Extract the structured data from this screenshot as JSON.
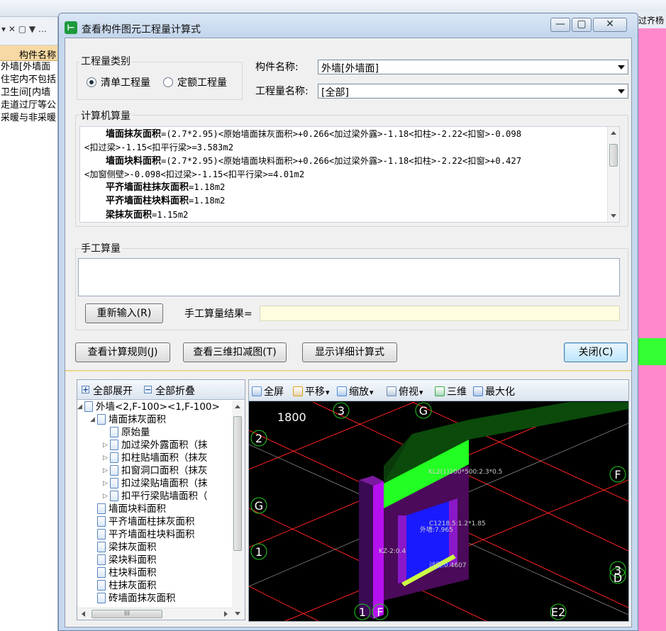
{
  "background_app": {
    "left_panel": {
      "filter_text": "▾ ✕ ▢ ▼ …",
      "header": "构件名称",
      "rows": [
        "外墙[外墙面",
        "住宅内不包括",
        "卫生间[内墙",
        "走道过厅等公",
        "采暖与非采暖"
      ]
    },
    "right_top_text": "过齐杨"
  },
  "dialog": {
    "title": "查看构件图元工程量计算式",
    "window_buttons": {
      "minimize": "—",
      "restore": "▢",
      "close": "✕"
    },
    "quantity_type": {
      "legend": "工程量类别",
      "options": [
        {
          "label": "清单工程量",
          "selected": true
        },
        {
          "label": "定额工程量",
          "selected": false
        }
      ]
    },
    "component_name": {
      "label": "构件名称:",
      "value": "外墙[外墙面]"
    },
    "quantity_name": {
      "label": "工程量名称:",
      "value": "[全部]"
    },
    "computer_calc": {
      "legend": "计算机算量",
      "lines": [
        {
          "name": "墙面抹灰面积",
          "expr": "=(2.7*2.95)<原始墙面抹灰面积>+0.266<加过梁外露>-1.18<扣柱>-2.22<扣窗>-0.098"
        },
        {
          "name": "",
          "expr": "<扣过梁>-1.15<扣平行梁>=3.583m2"
        },
        {
          "name": "墙面块料面积",
          "expr": "=(2.7*2.95)<原始墙面块料面积>+0.266<加过梁外露>-1.18<扣柱>-2.22<扣窗>+0.427"
        },
        {
          "name": "",
          "expr": "<加窗侧壁>-0.098<扣过梁>-1.15<扣平行梁>=4.01m2"
        },
        {
          "name": "平齐墙面柱抹灰面积",
          "expr": "=1.18m2"
        },
        {
          "name": "平齐墙面柱块料面积",
          "expr": "=1.18m2"
        },
        {
          "name": "梁抹灰面积",
          "expr": "=1.15m2"
        }
      ]
    },
    "manual_calc": {
      "legend": "手工算量",
      "input_value": "",
      "reinput_button": "重新输入(R)",
      "result_label": "手工算量结果=",
      "result_value": ""
    },
    "buttons": {
      "view_rules": "查看计算规则(J)",
      "view_3d": "查看三维扣减图(T)",
      "show_detail": "显示详细计算式",
      "close": "关闭(C)"
    },
    "tree": {
      "expand_all": "全部展开",
      "collapse_all": "全部折叠",
      "nodes": [
        {
          "text": "外墙<2,F-100><1,F-100>",
          "level": 0,
          "expander": "◢"
        },
        {
          "text": "墙面抹灰面积",
          "level": 1,
          "expander": "◢"
        },
        {
          "text": "原始量",
          "level": 2,
          "expander": ""
        },
        {
          "text": "加过梁外露面积（抹",
          "level": 2,
          "expander": "▷"
        },
        {
          "text": "扣柱贴墙面积（抹灰",
          "level": 2,
          "expander": "▷"
        },
        {
          "text": "扣窗洞口面积（抹灰",
          "level": 2,
          "expander": "▷"
        },
        {
          "text": "扣过梁贴墙面积（抹",
          "level": 2,
          "expander": "▷"
        },
        {
          "text": "扣平行梁贴墙面积（",
          "level": 2,
          "expander": "▷"
        },
        {
          "text": "墙面块料面积",
          "level": 1,
          "expander": ""
        },
        {
          "text": "平齐墙面柱抹灰面积",
          "level": 1,
          "expander": ""
        },
        {
          "text": "平齐墙面柱块料面积",
          "level": 1,
          "expander": ""
        },
        {
          "text": "梁抹灰面积",
          "level": 1,
          "expander": ""
        },
        {
          "text": "梁块料面积",
          "level": 1,
          "expander": ""
        },
        {
          "text": "柱块料面积",
          "level": 1,
          "expander": ""
        },
        {
          "text": "柱抹灰面积",
          "level": 1,
          "expander": ""
        },
        {
          "text": "砖墙面抹灰面积",
          "level": 1,
          "expander": ""
        }
      ],
      "hscroll_grip": "III"
    },
    "view3d": {
      "toolbar": [
        {
          "label": "全屏",
          "icon": "fullscreen-icon",
          "dropdown": false
        },
        {
          "label": "平移",
          "icon": "pan-icon",
          "dropdown": true
        },
        {
          "label": "缩放",
          "icon": "zoom-icon",
          "dropdown": true
        },
        {
          "label": "俯视",
          "icon": "top-view-icon",
          "dropdown": true
        },
        {
          "label": "三维",
          "icon": "3d-view-icon",
          "dropdown": false
        },
        {
          "label": "最大化",
          "icon": "maximize-icon",
          "dropdown": false
        }
      ],
      "dimension": "1800",
      "axis_labels": {
        "a3": "3",
        "g_top": "G",
        "a2": "2",
        "g_left": "G",
        "f_right": "F",
        "a1": "1",
        "d3": "3",
        "d": "D",
        "a1b": "1",
        "f": "F",
        "e2": "E2"
      },
      "annotations": {
        "beam": "KL2(1)200*500:2.3*0.5",
        "window": "C1218.5:1.2*1.85",
        "wall": "外墙:7.965",
        "column": "KZ-2:0.4",
        "lintel": "过梁:0.4607"
      },
      "colors": {
        "grid": "#ff2222",
        "beam": "#22ff22",
        "wall": "#aa22ee",
        "window": "#1a1aff",
        "lintel": "#ccff44",
        "axis_circle": "#22cc22"
      }
    }
  }
}
